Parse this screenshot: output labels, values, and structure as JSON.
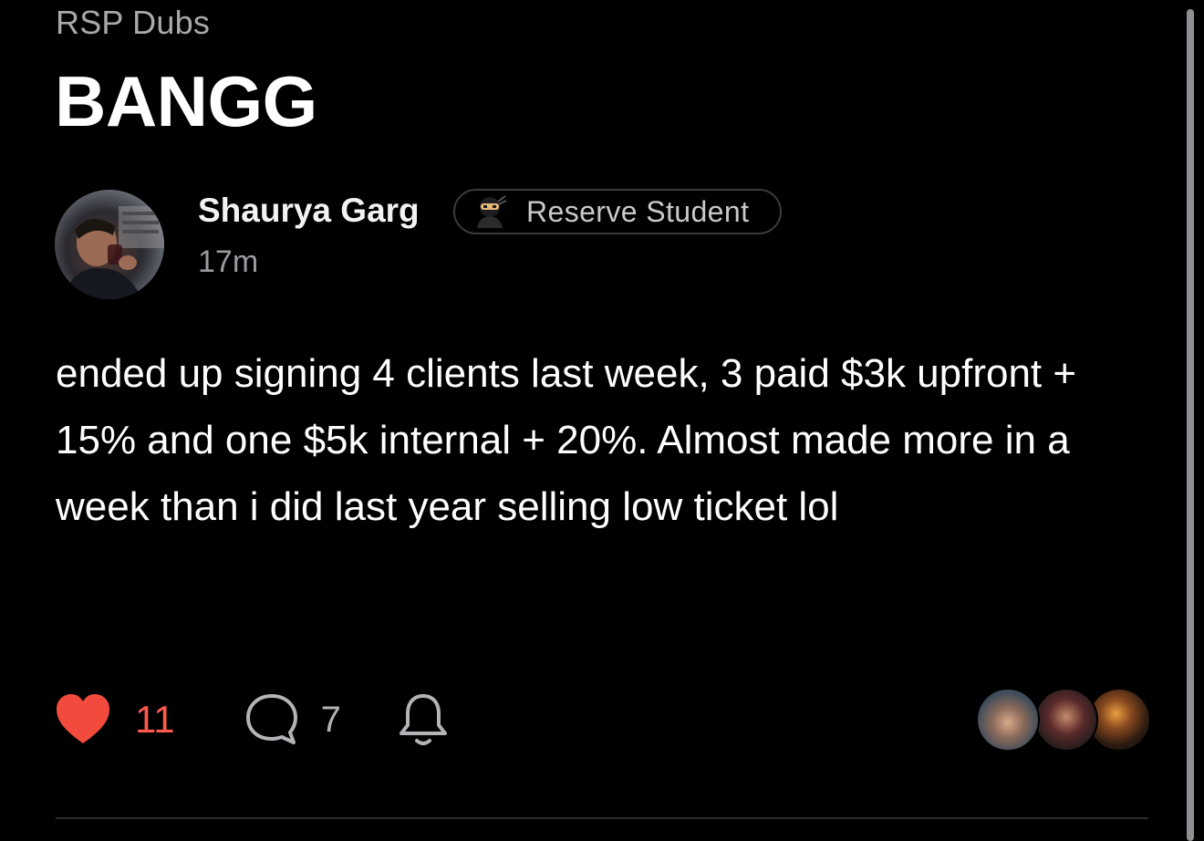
{
  "channel": "RSP Dubs",
  "post": {
    "title": "BANGG",
    "author": {
      "name": "Shaurya Garg",
      "badge": {
        "label": "Reserve Student",
        "icon": "ninja-icon"
      }
    },
    "time_ago": "17m",
    "body": "ended up signing 4 clients last week, 3 paid $3k upfront + 15% and one $5k internal + 20%. Almost made more in a week than i did last year selling low ticket lol",
    "actions": {
      "like_count": "11",
      "like_icon": "heart-icon",
      "comment_count": "7",
      "comment_icon": "comment-bubble-icon",
      "follow_icon": "bell-icon"
    }
  },
  "colors": {
    "background": "#000000",
    "like": "#f24b3e",
    "muted_text": "#9a9aa0"
  }
}
